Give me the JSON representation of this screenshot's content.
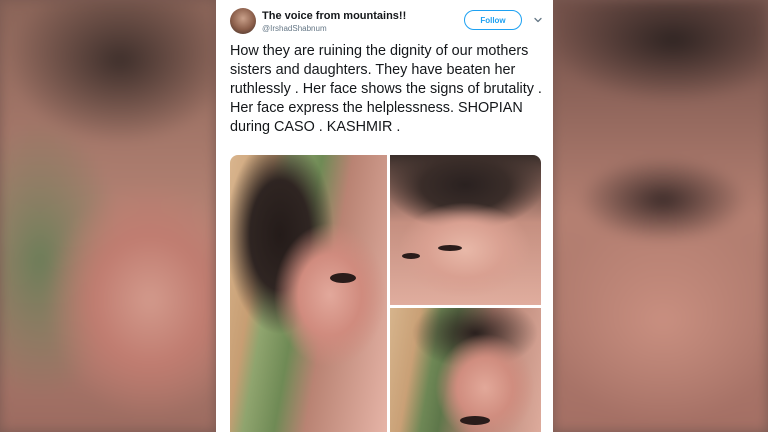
{
  "tweet": {
    "author_name": "The voice from mountains!!",
    "author_handle": "@IrshadShabnum",
    "follow_label": "Follow",
    "text": "How they are ruining the dignity of our mothers sisters and daughters. They have beaten her ruthlessly . Her face shows the signs of brutality . Her face express the helplessness. SHOPIAN during CASO . KASHMIR .",
    "photos": [
      "photo-1",
      "photo-2",
      "photo-3"
    ]
  },
  "colors": {
    "follow_accent": "#1da1f2",
    "text": "#14171a",
    "handle": "#657786"
  }
}
